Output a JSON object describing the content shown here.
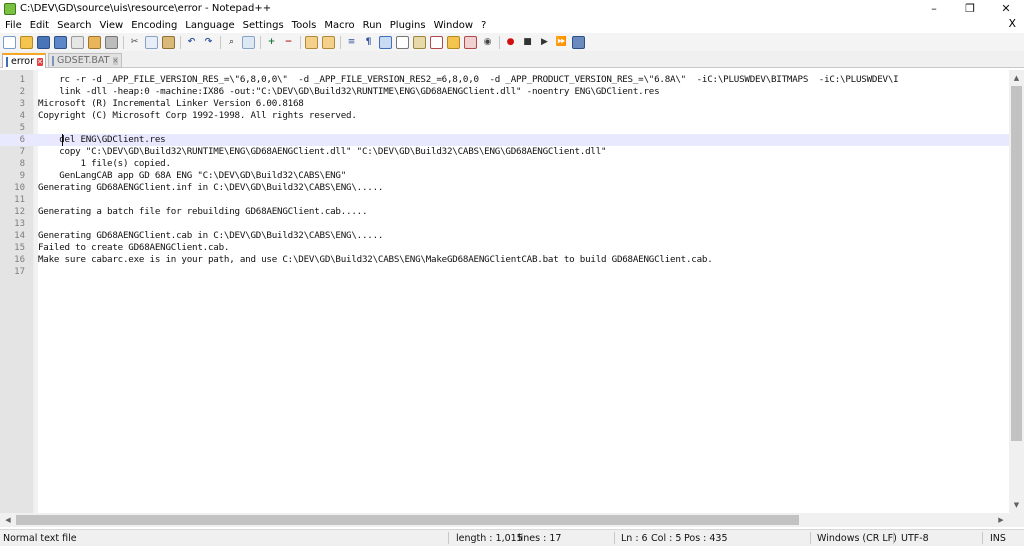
{
  "window": {
    "title": "C:\\DEV\\GD\\source\\uis\\resource\\error - Notepad++",
    "minimize_glyph": "–",
    "restore_glyph": "❐",
    "close_glyph": "✕"
  },
  "menu": {
    "items": [
      "File",
      "Edit",
      "Search",
      "View",
      "Encoding",
      "Language",
      "Settings",
      "Tools",
      "Macro",
      "Run",
      "Plugins",
      "Window",
      "?"
    ],
    "close_doc_glyph": "X"
  },
  "toolbar": {
    "icons": [
      "new-file-icon",
      "open-file-icon",
      "save-icon",
      "save-all-icon",
      "close-icon",
      "close-all-icon",
      "print-icon",
      "cut-icon",
      "copy-icon",
      "paste-icon",
      "undo-icon",
      "redo-icon",
      "find-icon",
      "replace-icon",
      "zoom-in-icon",
      "zoom-out-icon",
      "sync-vertical-icon",
      "sync-horizontal-icon",
      "word-wrap-icon",
      "show-all-chars-icon",
      "indent-guide-icon",
      "user-defined-language-icon",
      "document-map-icon",
      "function-list-icon",
      "folder-as-workspace-icon",
      "document-monitor-icon",
      "eye-icon",
      "record-macro-icon",
      "stop-recording-icon",
      "playback-macro-icon",
      "run-macro-multiple-icon",
      "save-macro-icon"
    ]
  },
  "tabs": [
    {
      "label": "error",
      "active": true
    },
    {
      "label": "GDSET.BAT",
      "active": false
    }
  ],
  "editor": {
    "current_line": 6,
    "lines": [
      "    rc -r -d _APP_FILE_VERSION_RES_=\\\"6,8,0,0\\\"  -d _APP_FILE_VERSION_RES2_=6,8,0,0  -d _APP_PRODUCT_VERSION_RES_=\\\"6.8A\\\"  -iC:\\PLUSWDEV\\BITMAPS  -iC:\\PLUSWDEV\\I",
      "    link -dll -heap:0 -machine:IX86 -out:\"C:\\DEV\\GD\\Build32\\RUNTIME\\ENG\\GD68AENGClient.dll\" -noentry ENG\\GDClient.res",
      "Microsoft (R) Incremental Linker Version 6.00.8168",
      "Copyright (C) Microsoft Corp 1992-1998. All rights reserved.",
      "",
      "    del ENG\\GDClient.res",
      "    copy \"C:\\DEV\\GD\\Build32\\RUNTIME\\ENG\\GD68AENGClient.dll\" \"C:\\DEV\\GD\\Build32\\CABS\\ENG\\GD68AENGClient.dll\"",
      "        1 file(s) copied.",
      "    GenLangCAB app GD 68A ENG \"C:\\DEV\\GD\\Build32\\CABS\\ENG\"",
      "Generating GD68AENGClient.inf in C:\\DEV\\GD\\Build32\\CABS\\ENG\\.....",
      "",
      "Generating a batch file for rebuilding GD68AENGClient.cab.....",
      "",
      "Generating GD68AENGClient.cab in C:\\DEV\\GD\\Build32\\CABS\\ENG\\.....",
      "Failed to create GD68AENGClient.cab.",
      "Make sure cabarc.exe is in your path, and use C:\\DEV\\GD\\Build32\\CABS\\ENG\\MakeGD68AENGClientCAB.bat to build GD68AENGClient.cab.",
      ""
    ]
  },
  "statusbar": {
    "file_type": "Normal text file",
    "length": "length : 1,015",
    "lines": "lines : 17",
    "ln": "Ln : 6",
    "col": "Col : 5",
    "pos": "Pos : 435",
    "eol": "Windows (CR LF)",
    "encoding": "UTF-8",
    "ins": "INS"
  }
}
